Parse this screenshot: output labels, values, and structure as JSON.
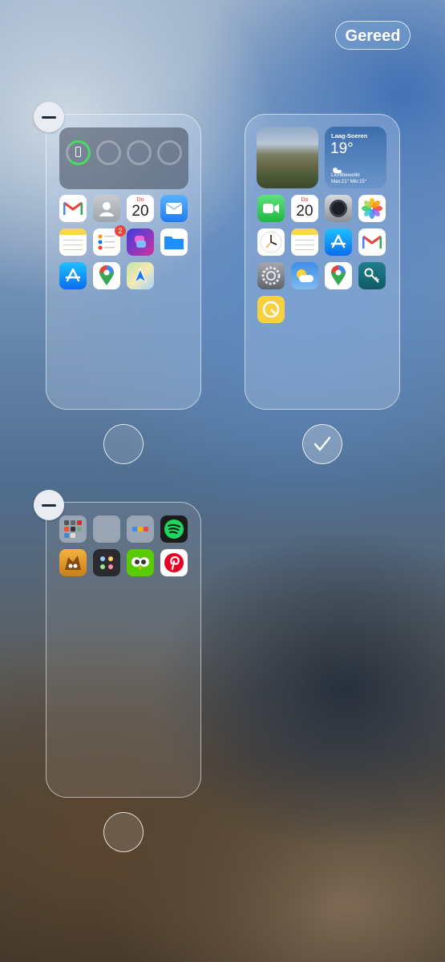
{
  "header": {
    "done_label": "Gereed"
  },
  "pages": [
    {
      "apps": [
        "Gmail",
        "Contacten",
        "Agenda",
        "Mail",
        "Notities",
        "Herinneringen",
        "Opdrachten",
        "Bestanden",
        "App Store",
        "Google Maps",
        "Kaarten"
      ],
      "calendar": {
        "day": "Do",
        "date": "20"
      },
      "reminders_badge": "2",
      "selected": false
    },
    {
      "apps": [
        "FaceTime",
        "Agenda",
        "Camera",
        "Foto's",
        "Klok",
        "Notities",
        "App Store",
        "Gmail",
        "Instellingen",
        "Weer",
        "Google Maps",
        "Wachtwoorden",
        "Taak"
      ],
      "calendar": {
        "day": "Do",
        "date": "20"
      },
      "weather": {
        "location": "Laag-Soeren",
        "temperature": "19°",
        "condition": "Lichtbewolkt",
        "range": "Max:21° Min:15°"
      },
      "selected": true
    },
    {
      "apps": [
        "Map 1",
        "Map 2",
        "Map 3",
        "Spotify",
        "Spel",
        "Launcher",
        "Duolingo",
        "Pinterest"
      ],
      "selected": false
    }
  ]
}
